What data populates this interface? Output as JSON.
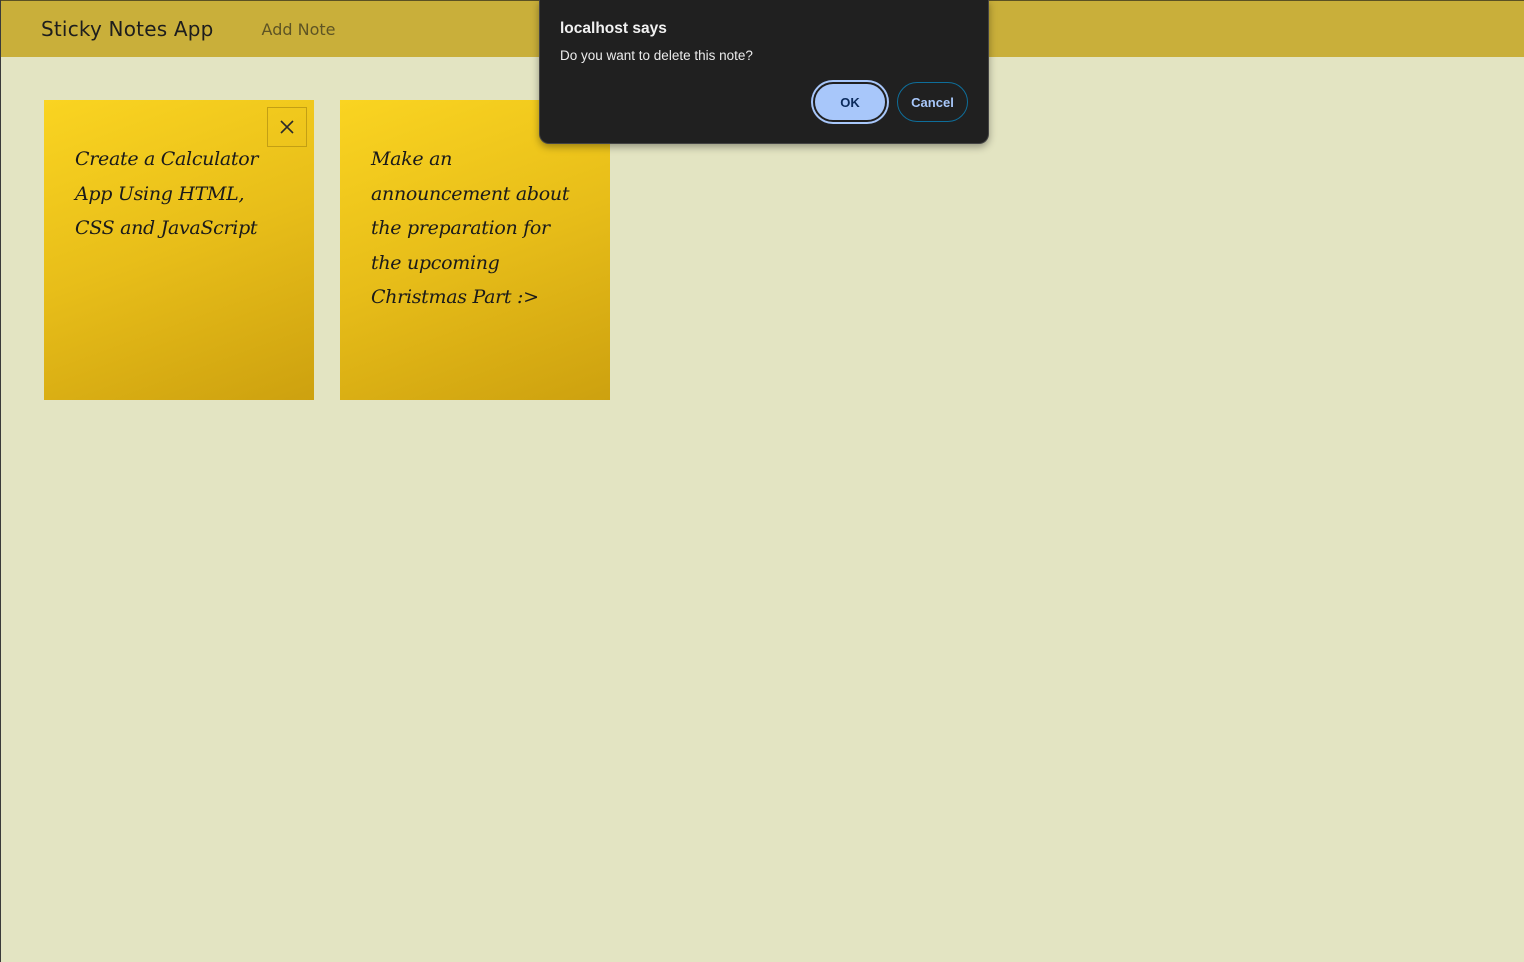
{
  "header": {
    "title": "Sticky Notes App",
    "add_note_label": "Add Note"
  },
  "notes": [
    {
      "text": "Create a Calculator App Using HTML, CSS and JavaScript",
      "close_label": "X"
    },
    {
      "text": "Make an announcement about the preparation for the upcoming Christmas Part :>"
    }
  ],
  "dialog": {
    "title": "localhost says",
    "message": "Do you want to delete this note?",
    "ok_label": "OK",
    "cancel_label": "Cancel"
  },
  "colors": {
    "background": "#e3e4c2",
    "header": "#c9af3a",
    "note_light": "#fad421",
    "note_dark": "#cda10f",
    "dialog_bg": "#202020",
    "ok_button": "#a8c7fa"
  },
  "icons": {
    "note_close": "close-icon"
  }
}
